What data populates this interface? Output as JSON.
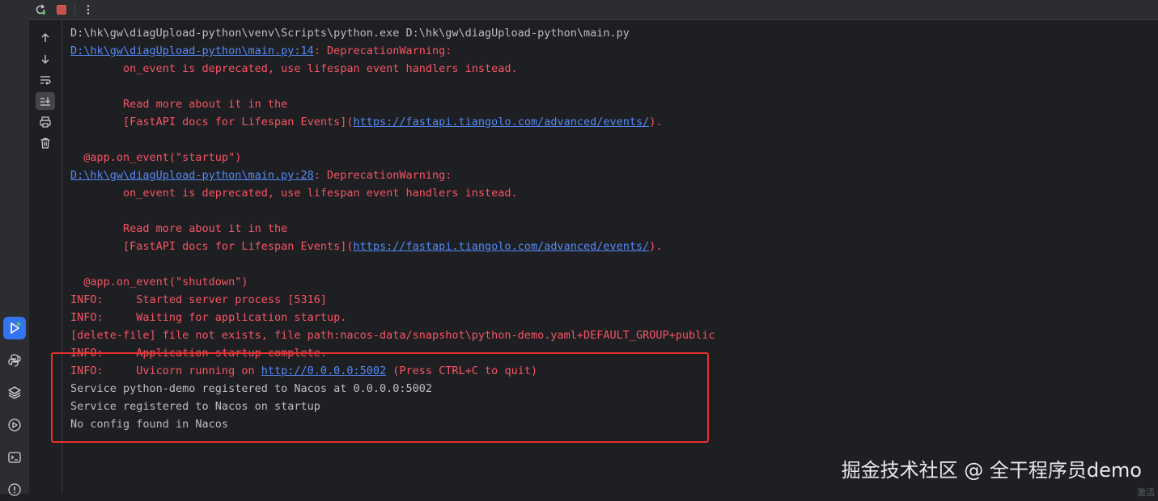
{
  "console": {
    "lines": [
      {
        "parts": [
          {
            "text": "D:\\hk\\gw\\diagUpload-python\\venv\\Scripts\\python.exe D:\\hk\\gw\\diagUpload-python\\main.py",
            "kind": "plain"
          }
        ]
      },
      {
        "parts": [
          {
            "text": "D:\\hk\\gw\\diagUpload-python\\main.py:14",
            "kind": "link"
          },
          {
            "text": ": DeprecationWarning:",
            "kind": "err"
          }
        ]
      },
      {
        "parts": [
          {
            "text": "        on_event is deprecated, use lifespan event handlers instead.",
            "kind": "err"
          }
        ]
      },
      {
        "parts": [
          {
            "text": "",
            "kind": "err"
          }
        ]
      },
      {
        "parts": [
          {
            "text": "        Read more about it in the",
            "kind": "err"
          }
        ]
      },
      {
        "parts": [
          {
            "text": "        [FastAPI docs for Lifespan Events](",
            "kind": "err"
          },
          {
            "text": "https://fastapi.tiangolo.com/advanced/events/",
            "kind": "link"
          },
          {
            "text": ").",
            "kind": "err"
          }
        ]
      },
      {
        "parts": [
          {
            "text": "",
            "kind": "err"
          }
        ]
      },
      {
        "parts": [
          {
            "text": "  @app.on_event(\"startup\")",
            "kind": "err"
          }
        ]
      },
      {
        "parts": [
          {
            "text": "D:\\hk\\gw\\diagUpload-python\\main.py:28",
            "kind": "link"
          },
          {
            "text": ": DeprecationWarning:",
            "kind": "err"
          }
        ]
      },
      {
        "parts": [
          {
            "text": "        on_event is deprecated, use lifespan event handlers instead.",
            "kind": "err"
          }
        ]
      },
      {
        "parts": [
          {
            "text": "",
            "kind": "err"
          }
        ]
      },
      {
        "parts": [
          {
            "text": "        Read more about it in the",
            "kind": "err"
          }
        ]
      },
      {
        "parts": [
          {
            "text": "        [FastAPI docs for Lifespan Events](",
            "kind": "err"
          },
          {
            "text": "https://fastapi.tiangolo.com/advanced/events/",
            "kind": "link"
          },
          {
            "text": ").",
            "kind": "err"
          }
        ]
      },
      {
        "parts": [
          {
            "text": "",
            "kind": "err"
          }
        ]
      },
      {
        "parts": [
          {
            "text": "  @app.on_event(\"shutdown\")",
            "kind": "err"
          }
        ]
      },
      {
        "parts": [
          {
            "text": "INFO:     Started server process [5316]",
            "kind": "err"
          }
        ]
      },
      {
        "parts": [
          {
            "text": "INFO:     Waiting for application startup.",
            "kind": "err"
          }
        ]
      },
      {
        "parts": [
          {
            "text": "[delete-file] file not exists, file path:nacos-data/snapshot\\python-demo.yaml+DEFAULT_GROUP+public",
            "kind": "err"
          }
        ]
      },
      {
        "parts": [
          {
            "text": "INFO:     Application startup complete.",
            "kind": "err"
          }
        ]
      },
      {
        "parts": [
          {
            "text": "INFO:     Uvicorn running on ",
            "kind": "err"
          },
          {
            "text": "http://0.0.0.0:5002",
            "kind": "link"
          },
          {
            "text": " (Press CTRL+C to quit)",
            "kind": "err"
          }
        ]
      },
      {
        "parts": [
          {
            "text": "Service python-demo registered to Nacos at 0.0.0.0:5002",
            "kind": "plain"
          }
        ]
      },
      {
        "parts": [
          {
            "text": "Service registered to Nacos on startup",
            "kind": "plain"
          }
        ]
      },
      {
        "parts": [
          {
            "text": "No config found in Nacos",
            "kind": "plain"
          }
        ]
      }
    ]
  },
  "watermark": "掘金技术社区 @ 全干程序员demo",
  "corner_text": "激活",
  "icons": {
    "top_toolbar": [
      "rerun-icon",
      "stop-icon",
      "more-vertical-icon"
    ],
    "console_toolbar": [
      "arrow-up-icon",
      "arrow-down-icon",
      "soft-wrap-icon",
      "scroll-to-end-icon",
      "print-icon",
      "trash-icon"
    ],
    "left_strip": [
      "run-icon",
      "python-console-icon",
      "layers-icon",
      "services-icon",
      "terminal-icon",
      "problems-icon"
    ]
  },
  "colors": {
    "background": "#1e1f22",
    "error_text": "#f75464",
    "link_text": "#548af7",
    "plain_text": "#bcbec4",
    "highlight_box": "#e8312e",
    "active_tool": "#3574f0"
  }
}
